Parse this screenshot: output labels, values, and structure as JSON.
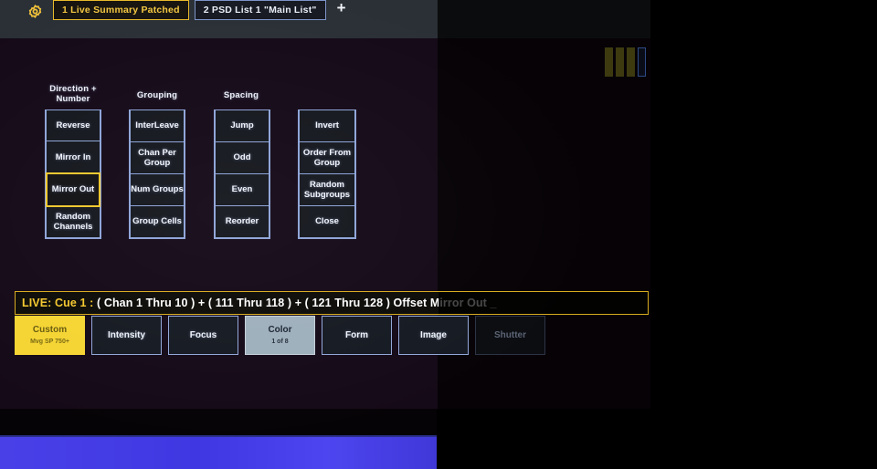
{
  "header": {
    "gear_icon": "gear-icon",
    "tabs": [
      {
        "label": "1 Live Summary Patched",
        "state": "active"
      },
      {
        "label": "2 PSD List 1 \"Main List\"",
        "state": "inactive"
      }
    ],
    "add_tab_label": "+"
  },
  "columns": [
    {
      "title": "Direction +\nNumber",
      "buttons": [
        {
          "label": "Reverse",
          "selected": false
        },
        {
          "label": "Mirror In",
          "selected": false
        },
        {
          "label": "Mirror Out",
          "selected": true
        },
        {
          "label": "Random\nChannels",
          "selected": false
        }
      ]
    },
    {
      "title": "Grouping",
      "buttons": [
        {
          "label": "InterLeave",
          "selected": false
        },
        {
          "label": "Chan Per\nGroup",
          "selected": false
        },
        {
          "label": "Num Groups",
          "selected": false
        },
        {
          "label": "Group Cells",
          "selected": false
        }
      ]
    },
    {
      "title": "Spacing",
      "buttons": [
        {
          "label": "Jump",
          "selected": false
        },
        {
          "label": "Odd",
          "selected": false
        },
        {
          "label": "Even",
          "selected": false
        },
        {
          "label": "Reorder",
          "selected": false
        }
      ]
    },
    {
      "title": "",
      "buttons": [
        {
          "label": "Invert",
          "selected": false
        },
        {
          "label": "Order From\nGroup",
          "selected": false
        },
        {
          "label": "Random\nSubgroups",
          "selected": false
        },
        {
          "label": "Close",
          "selected": false
        }
      ]
    }
  ],
  "command_line": {
    "prefix": "LIVE: Cue  1 :",
    "body": "( Chan 1 Thru 10 ) + ( 111 Thru 118 ) + ( 121 Thru 128 ) Offset Mirror Out _",
    "border_color": "#d8ab1f",
    "prefix_color": "#f5c932"
  },
  "category_tabs": [
    {
      "label": "Custom",
      "sub": "Mvg SP 750+",
      "state": "selected-yellow"
    },
    {
      "label": "Intensity",
      "sub": "",
      "state": "normal"
    },
    {
      "label": "Focus",
      "sub": "",
      "state": "normal"
    },
    {
      "label": "Color",
      "sub": "1 of 8",
      "state": "selected-grey"
    },
    {
      "label": "Form",
      "sub": "",
      "state": "normal"
    },
    {
      "label": "Image",
      "sub": "",
      "state": "normal"
    },
    {
      "label": "Shutter",
      "sub": "",
      "state": "dim"
    }
  ],
  "faders": [
    {
      "name": "fader-1",
      "style": "filled"
    },
    {
      "name": "fader-2",
      "style": "filled"
    },
    {
      "name": "fader-3",
      "style": "filled"
    },
    {
      "name": "fader-4",
      "style": "outlined"
    }
  ],
  "colors": {
    "accent_yellow": "#f5c932",
    "button_border_blue": "#8ea4d8",
    "background": "#150a18",
    "header_grey": "#2a3036",
    "bottom_band_blue": "#3b37e0"
  }
}
